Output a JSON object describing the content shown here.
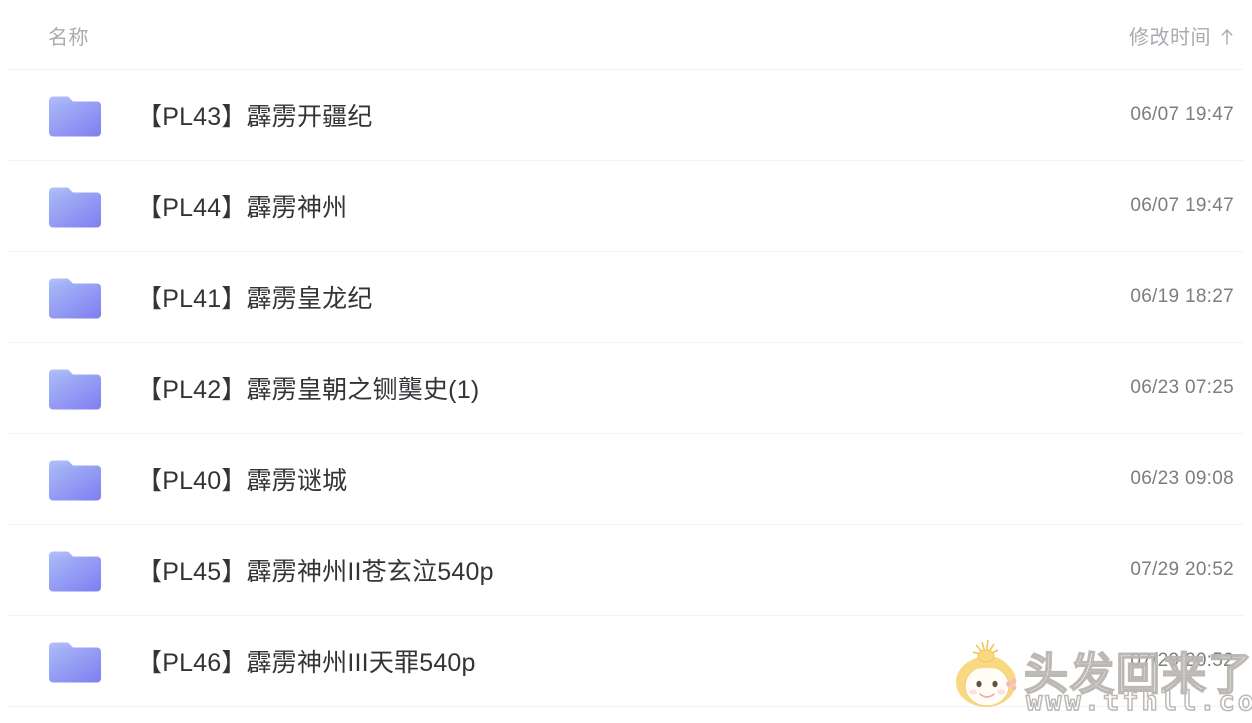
{
  "header": {
    "name_column": "名称",
    "time_column": "修改时间",
    "sort_icon": "arrow-up-icon",
    "sort_direction": "ascending"
  },
  "colors": {
    "folder_top": "#a7b8f7",
    "folder_bottom": "#7f7ef0",
    "separator": "#f2f3f5",
    "name_text": "#333437",
    "time_text": "#7c7d80",
    "header_text": "#a9abb0",
    "background": "#ffffff",
    "watermark_stroke": "#b9b6b1",
    "watermark_hair": "#f7d77a"
  },
  "files": [
    {
      "icon": "folder-icon",
      "name": "【PL43】霹雳开疆纪",
      "modified": "06/07 19:47"
    },
    {
      "icon": "folder-icon",
      "name": "【PL44】霹雳神州",
      "modified": "06/07 19:47"
    },
    {
      "icon": "folder-icon",
      "name": "【PL41】霹雳皇龙纪",
      "modified": "06/19 18:27"
    },
    {
      "icon": "folder-icon",
      "name": "【PL42】霹雳皇朝之铡龑史(1)",
      "modified": "06/23 07:25"
    },
    {
      "icon": "folder-icon",
      "name": "【PL40】霹雳谜城",
      "modified": "06/23 09:08"
    },
    {
      "icon": "folder-icon",
      "name": "【PL45】霹雳神州II苍玄泣540p",
      "modified": "07/29 20:52"
    },
    {
      "icon": "folder-icon",
      "name": "【PL46】霹雳神州III天罪540p",
      "modified": "07/29 20:52"
    }
  ],
  "watermark": {
    "logo": "cartoon-girl-face-icon",
    "title": "头发回来了",
    "url": "www.tfhll.com"
  }
}
